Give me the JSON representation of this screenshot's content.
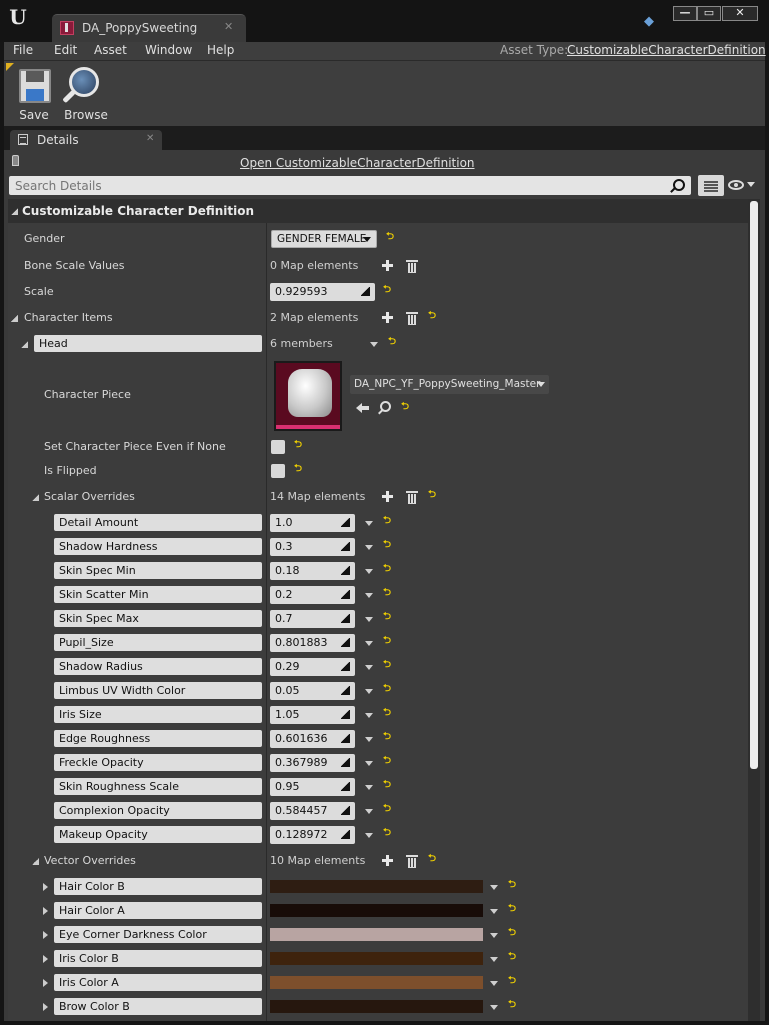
{
  "titlebar": {
    "logo": "U",
    "tab_title": "DA_PoppySweeting",
    "tab_close": "✕",
    "win_min": "—",
    "win_max": "▭",
    "win_close": "✕"
  },
  "menu": {
    "items": [
      "File",
      "Edit",
      "Asset",
      "Window",
      "Help"
    ],
    "asset_type_label": "Asset Type:",
    "asset_type_value": "CustomizableCharacterDefinition"
  },
  "toolbar": {
    "save_label": "Save",
    "browse_label": "Browse"
  },
  "details": {
    "tab_title": "Details",
    "tab_close": "✕",
    "open_link": "Open CustomizableCharacterDefinition",
    "search_placeholder": "Search Details",
    "category": "Customizable Character Definition",
    "gender_label": "Gender",
    "gender_value": "GENDER FEMALE",
    "bone_scale_label": "Bone Scale Values",
    "bone_scale_value": "0 Map elements",
    "scale_label": "Scale",
    "scale_value": "0.929593",
    "character_items_label": "Character Items",
    "character_items_value": "2 Map elements",
    "head_key": "Head",
    "head_members": "6 members",
    "character_piece_label": "Character Piece",
    "character_piece_value": "DA_NPC_YF_PoppySweeting_Master",
    "set_piece_label": "Set Character Piece Even if None",
    "is_flipped_label": "Is Flipped",
    "scalar_overrides_label": "Scalar Overrides",
    "scalar_overrides_value": "14 Map elements",
    "scalar_overrides": [
      {
        "name": "Detail Amount",
        "value": "1.0"
      },
      {
        "name": "Shadow Hardness",
        "value": "0.3"
      },
      {
        "name": "Skin Spec Min",
        "value": "0.18"
      },
      {
        "name": "Skin Scatter Min",
        "value": "0.2"
      },
      {
        "name": "Skin Spec Max",
        "value": "0.7"
      },
      {
        "name": "Pupil_Size",
        "value": "0.801883"
      },
      {
        "name": "Shadow Radius",
        "value": "0.29"
      },
      {
        "name": "Limbus UV Width Color",
        "value": "0.05"
      },
      {
        "name": "Iris Size",
        "value": "1.05"
      },
      {
        "name": "Edge Roughness",
        "value": "0.601636"
      },
      {
        "name": "Freckle Opacity",
        "value": "0.367989"
      },
      {
        "name": "Skin Roughness Scale",
        "value": "0.95"
      },
      {
        "name": "Complexion Opacity",
        "value": "0.584457"
      },
      {
        "name": "Makeup Opacity",
        "value": "0.128972"
      }
    ],
    "vector_overrides_label": "Vector Overrides",
    "vector_overrides_value": "10 Map elements",
    "vector_overrides": [
      {
        "name": "Hair Color B",
        "color": "#2e1d12"
      },
      {
        "name": "Hair Color A",
        "color": "#180c08"
      },
      {
        "name": "Eye Corner Darkness Color",
        "color": "#b8a4a2"
      },
      {
        "name": "Iris Color B",
        "color": "#3e230d"
      },
      {
        "name": "Iris Color A",
        "color": "#7d4f2c"
      },
      {
        "name": "Brow Color B",
        "color": "#26170e"
      }
    ],
    "reset_glyph": "⮌"
  }
}
